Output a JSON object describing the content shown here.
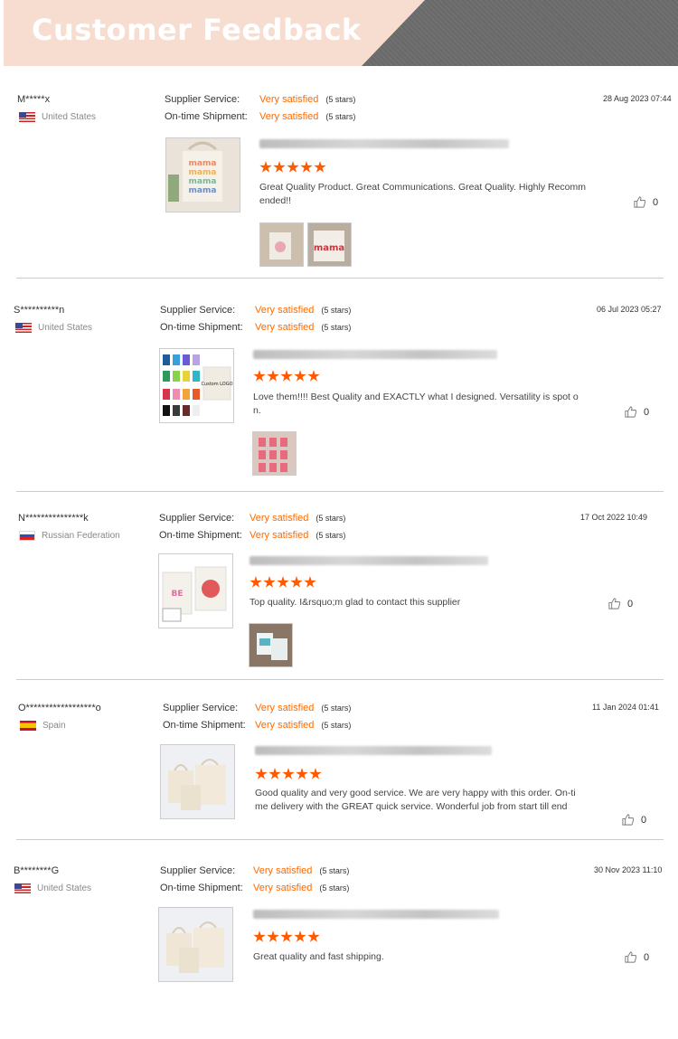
{
  "header": {
    "title": "Customer Feedback"
  },
  "labels": {
    "supplier_service": "Supplier Service:",
    "ontime_shipment": "On-time Shipment:"
  },
  "colors": {
    "accent": "#ff6a00",
    "header_bg": "#f6ddd0",
    "header_stripe": "#6a6a6a"
  },
  "reviews": [
    {
      "buyer": "M*****x",
      "country": "United States",
      "flag": "us-flag-icon",
      "supplier_rating": "Very satisfied",
      "supplier_stars": "(5 stars)",
      "shipment_rating": "Very satisfied",
      "shipment_stars": "(5 stars)",
      "date": "28 Aug 2023 07:44",
      "stars": 5,
      "comment": "Great Quality Product. Great Communications. Great Quality. Highly Recommended!!",
      "likes": "0"
    },
    {
      "buyer": "S**********n",
      "country": "United States",
      "flag": "us-flag-icon",
      "supplier_rating": "Very satisfied",
      "supplier_stars": "(5 stars)",
      "shipment_rating": "Very satisfied",
      "shipment_stars": "(5 stars)",
      "date": "06 Jul 2023 05:27",
      "stars": 5,
      "comment": "Love them!!!! Best Quality and EXACTLY what I designed. Versatility is spot on.",
      "likes": "0"
    },
    {
      "buyer": "N***************k",
      "country": "Russian Federation",
      "flag": "russia-flag-icon",
      "supplier_rating": "Very satisfied",
      "supplier_stars": "(5 stars)",
      "shipment_rating": "Very satisfied",
      "shipment_stars": "(5 stars)",
      "date": "17 Oct 2022 10:49",
      "stars": 5,
      "comment": "Top quality. I&rsquo;m glad to contact this supplier",
      "likes": "0"
    },
    {
      "buyer": "O******************o",
      "country": "Spain",
      "flag": "spain-flag-icon",
      "supplier_rating": "Very satisfied",
      "supplier_stars": "(5 stars)",
      "shipment_rating": "Very satisfied",
      "shipment_stars": "(5 stars)",
      "date": "11 Jan 2024 01:41",
      "stars": 5,
      "comment": "Good quality and very good service. We are very happy with this order. On-time delivery with the GREAT quick service. Wonderful job from start till end",
      "likes": "0"
    },
    {
      "buyer": "B********G",
      "country": "United States",
      "flag": "us-flag-icon",
      "supplier_rating": "Very satisfied",
      "supplier_stars": "(5 stars)",
      "shipment_rating": "Very satisfied",
      "shipment_stars": "(5 stars)",
      "date": "30 Nov 2023 11:10",
      "stars": 5,
      "comment": "Great quality and fast shipping.",
      "likes": "0"
    }
  ]
}
